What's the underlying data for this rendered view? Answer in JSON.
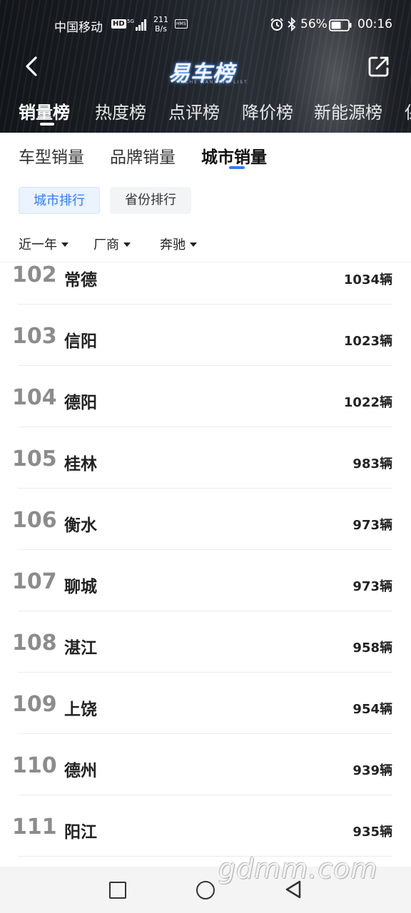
{
  "status_bar": {
    "carrier": "中国移动",
    "hd": "HD",
    "net_speed_value": "211",
    "net_speed_unit": "B/s",
    "hms": "HMS",
    "battery": "56%",
    "time": "00:16"
  },
  "header": {
    "logo_text": "易车榜",
    "logo_sub": "YICHE RANKING LIST"
  },
  "top_tabs": [
    {
      "label": "销量榜",
      "active": true
    },
    {
      "label": "热度榜",
      "active": false
    },
    {
      "label": "点评榜",
      "active": false
    },
    {
      "label": "降价榜",
      "active": false
    },
    {
      "label": "新能源榜",
      "active": false
    },
    {
      "label": "保",
      "active": false
    }
  ],
  "sub_tabs": [
    {
      "label": "车型销量",
      "active": false
    },
    {
      "label": "品牌销量",
      "active": false
    },
    {
      "label": "城市销量",
      "active": true
    }
  ],
  "chips": {
    "city_rank": "城市排行",
    "province_rank": "省份排行"
  },
  "filters": {
    "period": "近一年",
    "manufacturer": "厂商",
    "brand": "奔驰"
  },
  "rows": [
    {
      "rank": "102",
      "city": "常德",
      "count": "1034辆"
    },
    {
      "rank": "103",
      "city": "信阳",
      "count": "1023辆"
    },
    {
      "rank": "104",
      "city": "德阳",
      "count": "1022辆"
    },
    {
      "rank": "105",
      "city": "桂林",
      "count": "983辆"
    },
    {
      "rank": "106",
      "city": "衡水",
      "count": "973辆"
    },
    {
      "rank": "107",
      "city": "聊城",
      "count": "973辆"
    },
    {
      "rank": "108",
      "city": "湛江",
      "count": "958辆"
    },
    {
      "rank": "109",
      "city": "上饶",
      "count": "954辆"
    },
    {
      "rank": "110",
      "city": "德州",
      "count": "939辆"
    },
    {
      "rank": "111",
      "city": "阳江",
      "count": "935辆"
    }
  ],
  "watermark": "gdmm.com",
  "colors": {
    "accent": "#2e7cf6",
    "rank_gray": "#8c8c8c",
    "header_bg": "#1b1f25"
  }
}
